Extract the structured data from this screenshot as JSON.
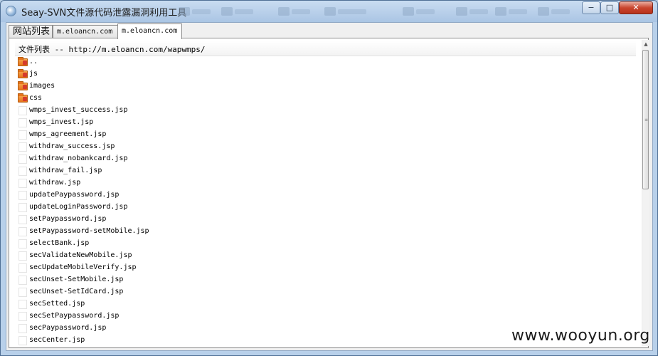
{
  "window": {
    "title": "Seay-SVN文件源代码泄露漏洞利用工具",
    "controls": {
      "minimize": "−",
      "maximize": "□",
      "close": "✕"
    }
  },
  "tabs": [
    {
      "label": "网站列表",
      "active": false
    },
    {
      "label": "m.eloancn.com",
      "active": false
    },
    {
      "label": "m.eloancn.com",
      "active": true
    }
  ],
  "file_list": {
    "header": "文件列表 -- http://m.eloancn.com/wapwmps/",
    "items": [
      {
        "name": "..",
        "type": "folder"
      },
      {
        "name": "js",
        "type": "folder"
      },
      {
        "name": "images",
        "type": "folder"
      },
      {
        "name": "css",
        "type": "folder"
      },
      {
        "name": "wmps_invest_success.jsp",
        "type": "file"
      },
      {
        "name": "wmps_invest.jsp",
        "type": "file"
      },
      {
        "name": "wmps_agreement.jsp",
        "type": "file"
      },
      {
        "name": "withdraw_success.jsp",
        "type": "file"
      },
      {
        "name": "withdraw_nobankcard.jsp",
        "type": "file"
      },
      {
        "name": "withdraw_fail.jsp",
        "type": "file"
      },
      {
        "name": "withdraw.jsp",
        "type": "file"
      },
      {
        "name": "updatePaypassword.jsp",
        "type": "file"
      },
      {
        "name": "updateLoginPassword.jsp",
        "type": "file"
      },
      {
        "name": "setPaypassword.jsp",
        "type": "file"
      },
      {
        "name": "setPaypassword-setMobile.jsp",
        "type": "file"
      },
      {
        "name": "selectBank.jsp",
        "type": "file"
      },
      {
        "name": "secValidateNewMobile.jsp",
        "type": "file"
      },
      {
        "name": "secUpdateMobileVerify.jsp",
        "type": "file"
      },
      {
        "name": "secUnset-SetMobile.jsp",
        "type": "file"
      },
      {
        "name": "secUnset-SetIdCard.jsp",
        "type": "file"
      },
      {
        "name": "secSetted.jsp",
        "type": "file"
      },
      {
        "name": "secSetPaypassword.jsp",
        "type": "file"
      },
      {
        "name": "secPaypassword.jsp",
        "type": "file"
      },
      {
        "name": "secCenter.jsp",
        "type": "file"
      }
    ]
  },
  "scrollbar": {
    "up": "▲",
    "down": "▼",
    "grip": "≡",
    "position": 0
  },
  "watermark": "www.wooyun.org"
}
